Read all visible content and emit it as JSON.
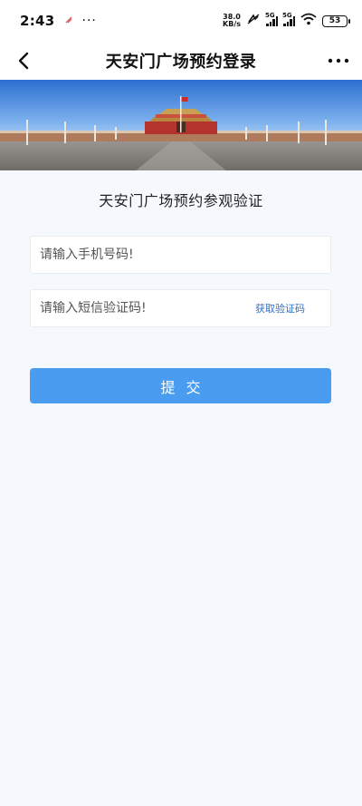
{
  "status_bar": {
    "time": "2:43",
    "dots": "···",
    "net_speed_value": "38.0",
    "net_speed_unit": "KB/s",
    "sim1_tag": "5G",
    "sim2_tag": "5G",
    "battery": "53"
  },
  "nav": {
    "title": "天安门广场预约登录",
    "back_icon": "chevron-left-icon",
    "more_icon": "more-horizontal-icon"
  },
  "banner": {
    "image": "tiananmen-square-photo"
  },
  "form": {
    "title": "天安门广场预约参观验证",
    "phone_placeholder": "请输入手机号码!",
    "phone_value": "",
    "code_placeholder": "请输入短信验证码!",
    "code_value": "",
    "get_code_label": "获取验证码",
    "submit_label": "提交"
  },
  "colors": {
    "primary_button": "#4a9cf0",
    "link": "#2f6fc7",
    "page_background": "#f5f9fe"
  }
}
